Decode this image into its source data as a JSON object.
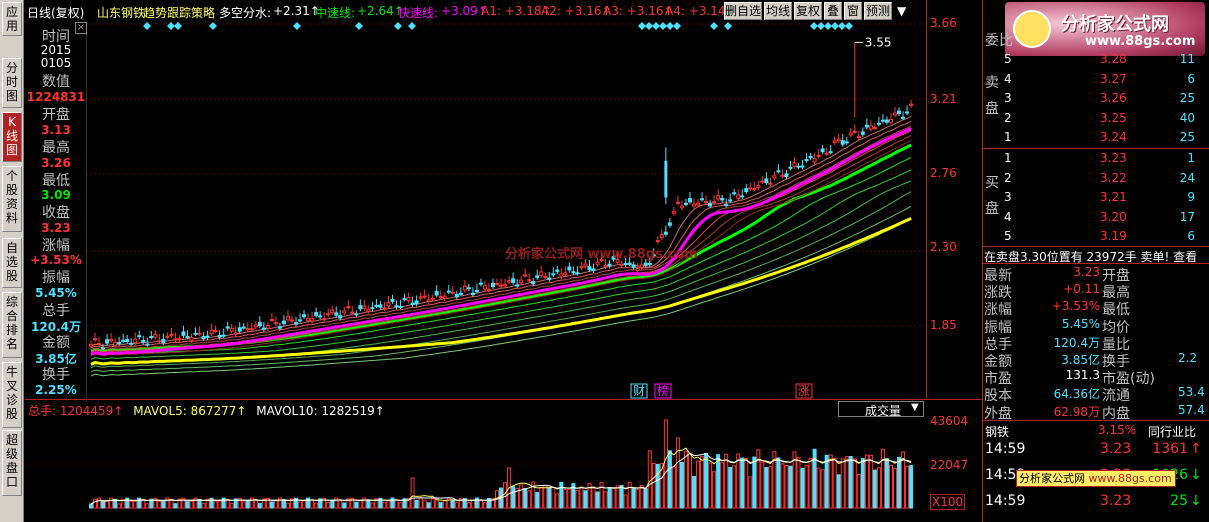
{
  "nav": [
    {
      "label": "应用",
      "top": 2,
      "h": 34,
      "active": false
    },
    {
      "label": "分时图",
      "top": 58,
      "h": 50,
      "active": false
    },
    {
      "label": "K线图",
      "top": 112,
      "h": 50,
      "active": true
    },
    {
      "label": "个股资料",
      "top": 166,
      "h": 66,
      "active": false
    },
    {
      "label": "自选股",
      "top": 238,
      "h": 50,
      "active": false
    },
    {
      "label": "综合排名",
      "top": 292,
      "h": 66,
      "active": false
    },
    {
      "label": "牛叉诊股",
      "top": 362,
      "h": 66,
      "active": false
    },
    {
      "label": "超级盘口",
      "top": 430,
      "h": 66,
      "active": false
    }
  ],
  "topbar": {
    "period": "日线(复权)",
    "stock": "山东钢铁",
    "strategy": "趋势跟踪策略",
    "dk_label": "多空分水:",
    "dk_val": "+2.31↑",
    "mid_label": "中速线:",
    "mid_val": "+2.64↑",
    "fast_label": "快速线:",
    "fast_val": "+3.09↑",
    "a1": "A1: +3.18↑",
    "a2": "A2: +3.16↑",
    "a3": "A3: +3.16↑",
    "a4": "A4: +3.14",
    "buttons": [
      "删自选",
      "均线",
      "复权",
      "叠",
      "窗",
      "预测"
    ],
    "arrow": "▼"
  },
  "info": {
    "time_label": "时间",
    "date_year": "2015",
    "date_md": "0105",
    "num_label": "数值",
    "num_val": "1224831",
    "open_label": "开盘",
    "open_val": "3.13",
    "high_label": "最高",
    "high_val": "3.26",
    "low_label": "最低",
    "low_val": "3.09",
    "close_label": "收盘",
    "close_val": "3.23",
    "chg_label": "涨幅",
    "chg_val": "+3.53%",
    "amp_label": "振幅",
    "amp_val": "5.45%",
    "vol_label": "总手",
    "vol_val": "120.4万",
    "amt_label": "金额",
    "amt_val": "3.85亿",
    "turn_label": "换手",
    "turn_val": "2.25%"
  },
  "chart": {
    "y_ticks": [
      "3.66",
      "3.21",
      "2.76",
      "2.30",
      "1.85"
    ],
    "peak_label": "3.55",
    "markers": [
      "财",
      "榜",
      "涨"
    ],
    "watermark": "分析家公式网 www.88gs.com"
  },
  "volume": {
    "legend_total": "总手: 1204459↑",
    "legend_ma5": "MAVOL5: 867277↑",
    "legend_ma10": "MAVOL10: 1282519↑",
    "button": "成交量",
    "y_ticks": [
      "43604",
      "22047"
    ],
    "unit": "X100"
  },
  "orderbook": {
    "title": "委比",
    "sell_label": "卖盘",
    "buy_label": "买盘",
    "sells": [
      [
        "5",
        "3.28",
        "11"
      ],
      [
        "4",
        "3.27",
        "6"
      ],
      [
        "3",
        "3.26",
        "25"
      ],
      [
        "2",
        "3.25",
        "40"
      ],
      [
        "1",
        "3.24",
        "25"
      ]
    ],
    "buys": [
      [
        "1",
        "3.23",
        "1"
      ],
      [
        "2",
        "3.22",
        "24"
      ],
      [
        "3",
        "3.21",
        "9"
      ],
      [
        "4",
        "3.20",
        "17"
      ],
      [
        "5",
        "3.19",
        "6"
      ]
    ],
    "notice": "在卖盘3.30位置有 23972手 卖单! 查看"
  },
  "quote": {
    "rows": [
      [
        "最新",
        "3.23",
        "开盘",
        ""
      ],
      [
        "涨跌",
        "+0.11",
        "最高",
        ""
      ],
      [
        "涨幅",
        "+3.53%",
        "最低",
        ""
      ],
      [
        "振幅",
        "5.45%",
        "均价",
        ""
      ],
      [
        "总手",
        "120.4万",
        "量比",
        ""
      ],
      [
        "金额",
        "3.85亿",
        "换手",
        "2.2"
      ],
      [
        "市盈",
        "131.3",
        "市盈(动)",
        ""
      ],
      [
        "股本",
        "64.36亿",
        "流通",
        "53.4"
      ],
      [
        "外盘",
        "62.98万",
        "内盘",
        "57.4"
      ]
    ],
    "sector": "钢铁",
    "sector_pct": "3.15%",
    "peer_label": "同行业比"
  },
  "ticks": [
    [
      "14:59",
      "3.23",
      "1361",
      "↑"
    ],
    [
      "14:59",
      "3.23",
      "1026",
      "↓"
    ],
    [
      "14:59",
      "3.23",
      "25",
      "↓"
    ]
  ],
  "logo": {
    "text": "分析家公式网",
    "url": "www.88gs.com"
  },
  "colors": {
    "red": "#ff3232",
    "green": "#00e600",
    "cyan": "#4de1ff",
    "yellow": "#ffff00",
    "magenta": "#ff00ff"
  }
}
